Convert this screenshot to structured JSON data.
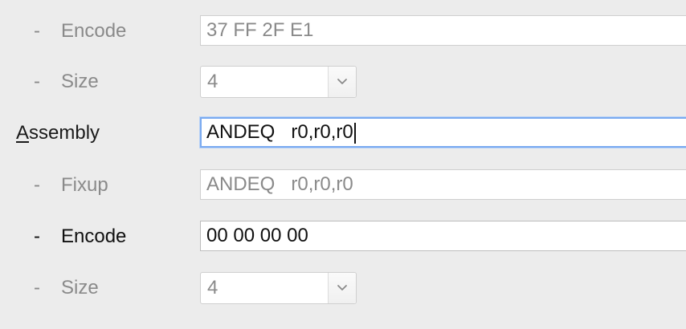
{
  "rows": {
    "encode1": {
      "dash": "-",
      "label": "Encode",
      "value": "37 FF 2F E1"
    },
    "size1": {
      "dash": "-",
      "label": "Size",
      "value": "4"
    },
    "assembly": {
      "label_mnemonic": "A",
      "label_rest": "ssembly",
      "value": "ANDEQ   r0,r0,r0"
    },
    "fixup": {
      "dash": "-",
      "label": "Fixup",
      "value": "ANDEQ   r0,r0,r0"
    },
    "encode2": {
      "dash": "-",
      "label": "Encode",
      "value": "00 00 00 00"
    },
    "size2": {
      "dash": "-",
      "label": "Size",
      "value": "4"
    }
  },
  "icons": {
    "dropdown": "chevron-down-icon"
  },
  "colors": {
    "background": "#ececec",
    "focus_ring": "#7aaaf0",
    "disabled_text": "#8a8a8a",
    "active_text": "#111111"
  }
}
